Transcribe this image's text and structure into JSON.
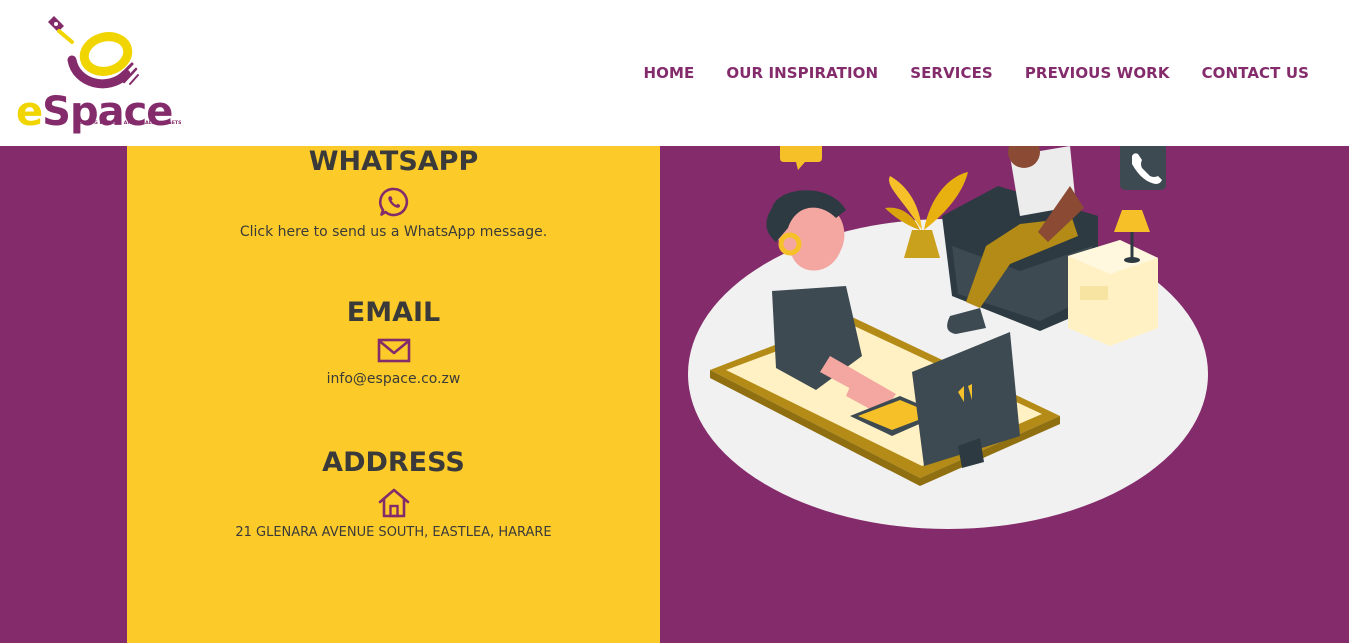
{
  "brand": {
    "name_first": "e",
    "name_rest": "Space",
    "tagline": "FOR BIG DREAMS AND SMALL BUDGETS"
  },
  "nav": {
    "items": [
      "HOME",
      "OUR INSPIRATION",
      "SERVICES",
      "PREVIOUS WORK",
      "CONTACT US"
    ]
  },
  "contact": {
    "whatsapp": {
      "heading": "WHATSAPP",
      "text": "Click here to send us a WhatsApp message.",
      "icon": "whatsapp-icon"
    },
    "email": {
      "heading": "EMAIL",
      "text": "info@espace.co.zw",
      "icon": "envelope-icon"
    },
    "address": {
      "heading": "ADDRESS",
      "text": "21 GLENARA AVENUE SOUTH, EASTLEA, HARARE",
      "icon": "house-icon"
    }
  },
  "colors": {
    "brand_purple": "#842b6b",
    "panel_yellow": "#fccb29",
    "logo_yellow": "#f1d500",
    "heading_text": "#3a3a3a"
  }
}
